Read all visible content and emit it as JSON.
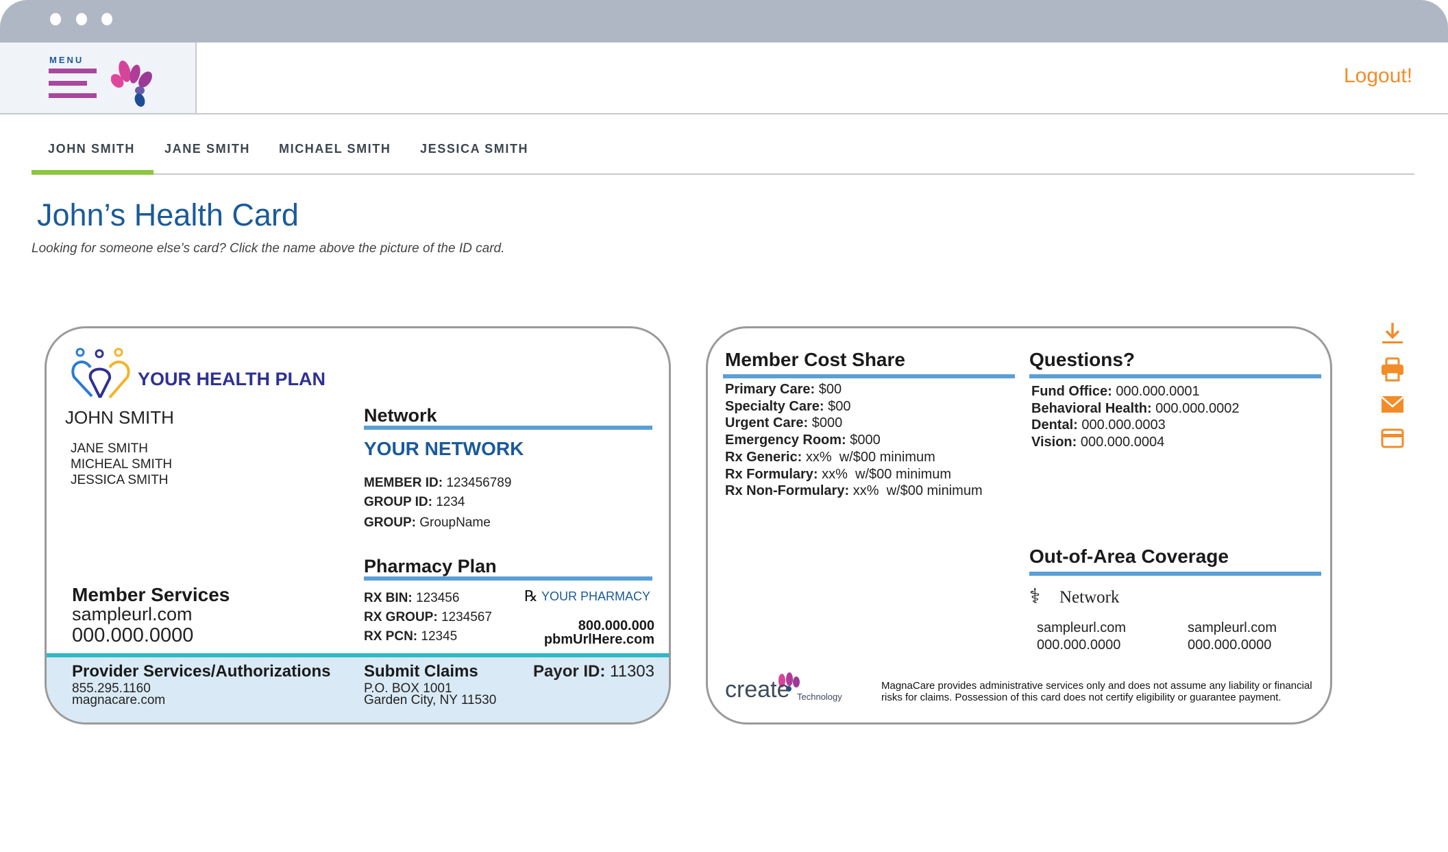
{
  "window": {
    "controls": [
      "close",
      "minimize",
      "maximize"
    ]
  },
  "header": {
    "menu_label": "MENU",
    "logout": "Logout!",
    "colors": {
      "menu": "#a8479e",
      "logout": "#f28c28"
    }
  },
  "tabs": [
    {
      "label": "JOHN SMITH",
      "active": true
    },
    {
      "label": "JANE SMITH"
    },
    {
      "label": "MICHAEL SMITH"
    },
    {
      "label": "JESSICA SMITH"
    }
  ],
  "page": {
    "title": "John’s Health Card",
    "subtitle": "Looking for someone else’s card? Click the name above the picture of the ID card."
  },
  "front": {
    "plan_name": "YOUR HEALTH PLAN",
    "member": "JOHN SMITH",
    "dependents": [
      "JANE SMITH",
      "MICHEAL SMITH",
      "JESSICA SMITH"
    ],
    "network_heading": "Network",
    "network_name": "YOUR NETWORK",
    "ids": [
      {
        "label": "MEMBER ID:",
        "value": "123456789"
      },
      {
        "label": "GROUP ID:",
        "value": "1234"
      },
      {
        "label": "GROUP:",
        "value": "GroupName"
      }
    ],
    "pharmacy_heading": "Pharmacy Plan",
    "rx": [
      {
        "label": "RX BIN:",
        "value": "123456"
      },
      {
        "label": "RX GROUP:",
        "value": "1234567"
      },
      {
        "label": "RX PCN:",
        "value": "12345"
      }
    ],
    "pharmacy_name": "YOUR PHARMACY",
    "pharmacy_phone": "800.000.000",
    "pharmacy_url": "pbmUrlHere.com",
    "member_services": {
      "heading": "Member Services",
      "url": "sampleurl.com",
      "phone": "000.000.0000"
    },
    "provider": {
      "heading": "Provider Services/Authorizations",
      "phone": "855.295.1160",
      "url": "magnacare.com"
    },
    "claims": {
      "heading": "Submit Claims",
      "line1": "P.O. BOX 1001",
      "line2": "Garden City, NY 11530"
    },
    "payor": {
      "label": "Payor ID:",
      "value": "11303"
    }
  },
  "back": {
    "cost_heading": "Member Cost Share",
    "costs": [
      {
        "label": "Primary Care:",
        "value": "$00"
      },
      {
        "label": "Specialty Care:",
        "value": "$00"
      },
      {
        "label": "Urgent Care:",
        "value": "$000"
      },
      {
        "label": "Emergency Room:",
        "value": "$000"
      },
      {
        "label": "Rx Generic:",
        "value": "xx%  w/$00 minimum"
      },
      {
        "label": "Rx Formulary:",
        "value": "xx%  w/$00 minimum"
      },
      {
        "label": "Rx Non-Formulary:",
        "value": "xx%  w/$00 minimum"
      }
    ],
    "questions_heading": "Questions?",
    "questions": [
      {
        "label": "Fund Office:",
        "value": "000.000.0001"
      },
      {
        "label": "Behavioral Health:",
        "value": "000.000.0002"
      },
      {
        "label": "Dental:",
        "value": "000.000.0003"
      },
      {
        "label": "Vision:",
        "value": "000.000.0004"
      }
    ],
    "oac_heading": "Out-of-Area Coverage",
    "oac_network": "Network",
    "oac_cols": [
      {
        "url": "sampleurl.com",
        "phone": "000.000.0000"
      },
      {
        "url": "sampleurl.com",
        "phone": "000.000.0000"
      }
    ],
    "logo_text": "create",
    "logo_sub": "Technology",
    "disclaimer": "MagnaCare provides administrative services only and does not assume any liability or financial risks for claims. Possession of this card does not certify eligibility or guarantee payment."
  },
  "actions": [
    {
      "icon": "download-icon"
    },
    {
      "icon": "print-icon"
    },
    {
      "icon": "email-icon"
    },
    {
      "icon": "card-icon"
    }
  ]
}
